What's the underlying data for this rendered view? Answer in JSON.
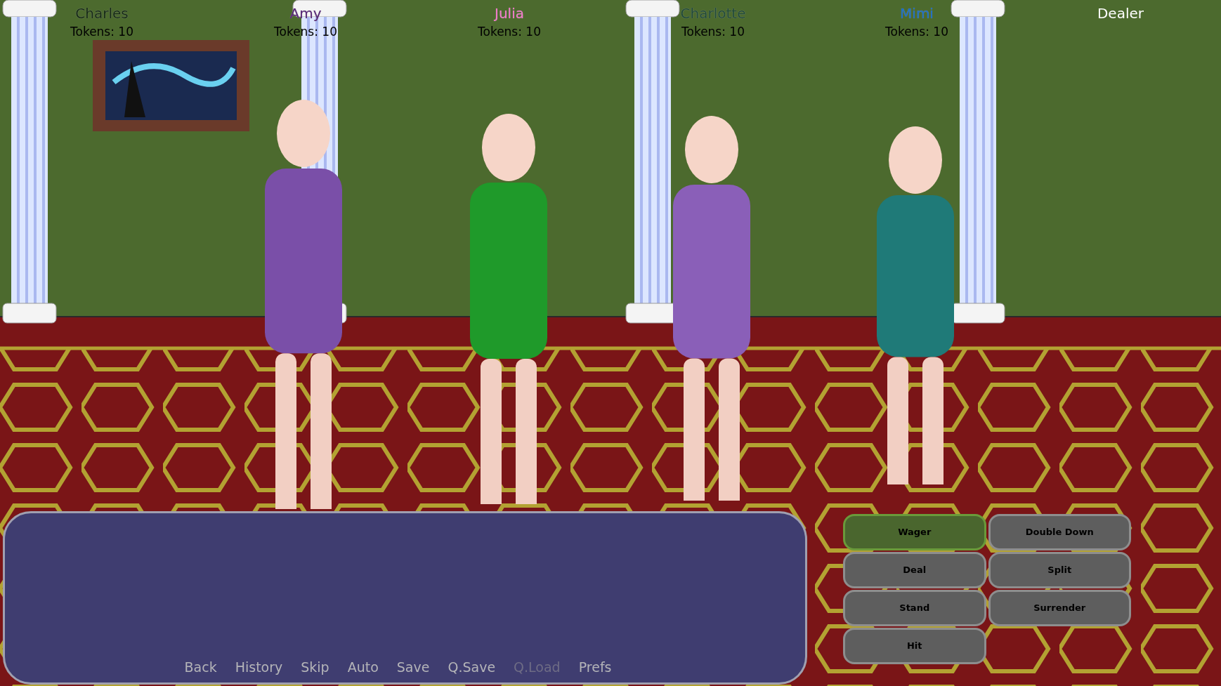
{
  "players": [
    {
      "name": "Charles",
      "tokens": "Tokens: 10",
      "color": "#142a12"
    },
    {
      "name": "Amy",
      "tokens": "Tokens: 10",
      "color": "#5a2a7a"
    },
    {
      "name": "Julia",
      "tokens": "Tokens: 10",
      "color": "#f27ac8"
    },
    {
      "name": "Charlotte",
      "tokens": "Tokens: 10",
      "color": "#1f4a36"
    },
    {
      "name": "Mimi",
      "tokens": "Tokens: 10",
      "color": "#1a6fc8"
    },
    {
      "name": "Dealer",
      "color": "#ffffff"
    }
  ],
  "actions": [
    {
      "label": "Wager",
      "selected": true
    },
    {
      "label": "Double Down",
      "selected": false
    },
    {
      "label": "Deal",
      "selected": false
    },
    {
      "label": "Split",
      "selected": false
    },
    {
      "label": "Stand",
      "selected": false
    },
    {
      "label": "Surrender",
      "selected": false
    },
    {
      "label": "Hit",
      "selected": false
    }
  ],
  "quick_menu": [
    {
      "label": "Back",
      "disabled": false
    },
    {
      "label": "History",
      "disabled": false
    },
    {
      "label": "Skip",
      "disabled": false
    },
    {
      "label": "Auto",
      "disabled": false
    },
    {
      "label": "Save",
      "disabled": false
    },
    {
      "label": "Q.Save",
      "disabled": false
    },
    {
      "label": "Q.Load",
      "disabled": true
    },
    {
      "label": "Prefs",
      "disabled": false
    }
  ]
}
